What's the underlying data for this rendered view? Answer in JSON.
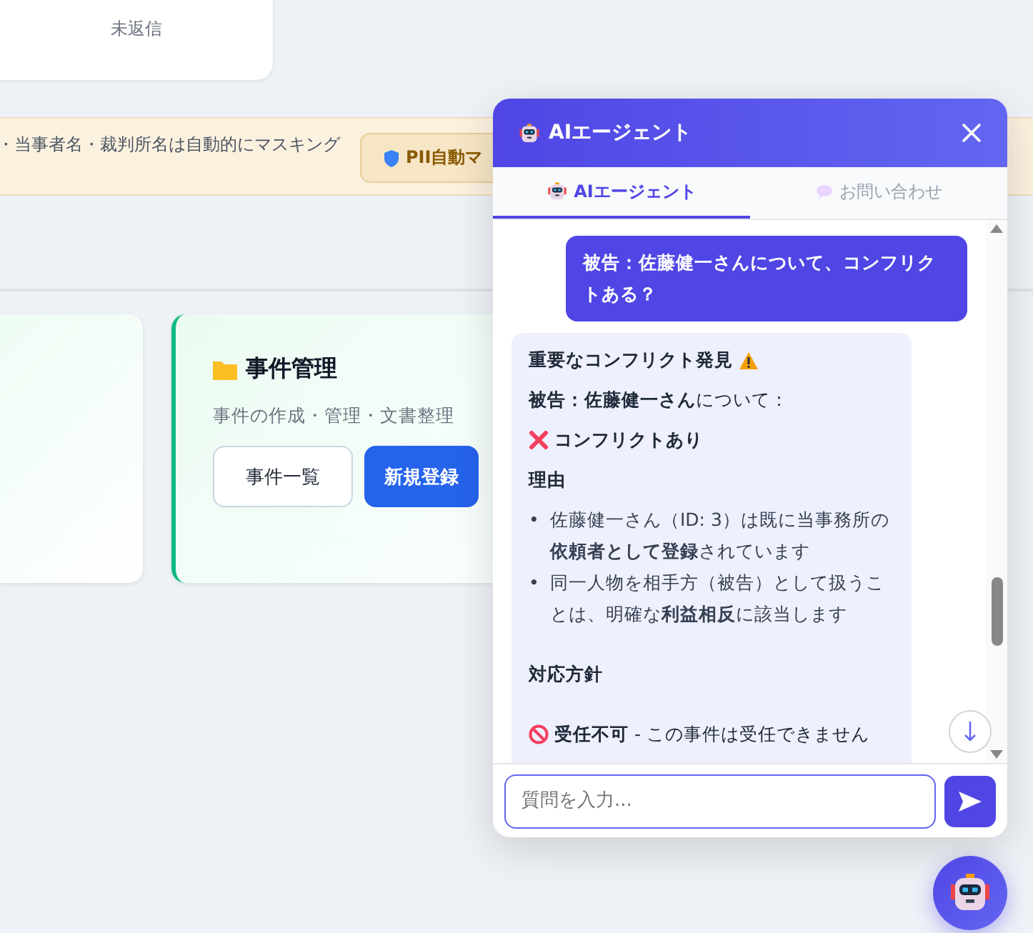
{
  "top_card": {
    "status": "未返信"
  },
  "notice": {
    "text": "・当事者名・裁判所名は自動的にマスキング",
    "badge": "PII自動マ"
  },
  "cards": [
    {
      "kind": "blank"
    },
    {
      "kind": "feature",
      "title": "事件管理",
      "description": "事件の作成・管理・文書整理",
      "buttons": [
        {
          "label": "事件一覧",
          "primary": false
        },
        {
          "label": "新規登録",
          "primary": true
        }
      ]
    }
  ],
  "chat": {
    "title": "AIエージェント",
    "tabs": [
      {
        "label": "AIエージェント",
        "kind": "agent",
        "selected": true
      },
      {
        "label": "お問い合わせ",
        "kind": "inquiry",
        "selected": false
      }
    ],
    "messages": [
      {
        "kind": "user",
        "text": "被告：佐藤健一さんについて、コンフリクトある？"
      },
      {
        "kind": "agent",
        "blocks": [
          {
            "kind": "heading",
            "text": "重要なコンフリクト発見"
          },
          {
            "kind": "para",
            "text": "**被告：佐藤健一さん**について："
          },
          {
            "kind": "status",
            "text": "コンフリクトあり"
          },
          {
            "kind": "subheading",
            "text": "理由"
          },
          {
            "kind": "bullets",
            "marker": "•",
            "items": [
              "佐藤健一さん（ID: 3）は既に当事務所の**依頼者として登録**されています",
              "同一人物を相手方（被告）として扱うことは、明確な**利益相反**に該当します"
            ]
          },
          {
            "kind": "section",
            "text": "対応方針"
          },
          {
            "kind": "verdict",
            "text": "**受任不可** - この事件は受任できません"
          }
        ]
      }
    ],
    "input": {
      "placeholder": "質問を入力..."
    }
  }
}
